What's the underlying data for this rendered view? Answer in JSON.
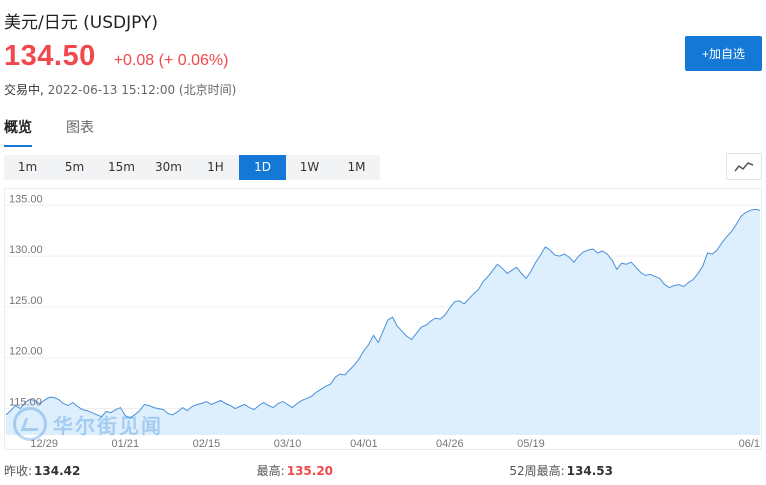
{
  "header": {
    "title": "美元/日元  (USDJPY)",
    "price": "134.50",
    "change": "+0.08 (+ 0.06%)",
    "status": "交易中,",
    "datetime": " 2022-06-13 15:12:00 (北京时间)"
  },
  "watch_button_label": "+加自选",
  "tabs": [
    {
      "label": "概览",
      "active": true
    },
    {
      "label": "图表",
      "active": false
    }
  ],
  "periods": [
    {
      "label": "1m"
    },
    {
      "label": "5m"
    },
    {
      "label": "15m"
    },
    {
      "label": "30m"
    },
    {
      "label": "1H"
    },
    {
      "label": "1D",
      "active": true
    },
    {
      "label": "1W"
    },
    {
      "label": "1M"
    }
  ],
  "chart_toggle_icon": "line-chart-icon",
  "watermark": {
    "text": "华尔街见闻",
    "icon": "wallstreetcn-logo-icon"
  },
  "colors": {
    "accent": "#1478d7",
    "up": "#f0484c",
    "area_fill": "#ddeefc",
    "line": "#4a90d9"
  },
  "stats": [
    {
      "label": "昨收:",
      "value": "134.42",
      "highlight": false
    },
    {
      "label": "最高:",
      "value": "135.20",
      "highlight": true
    },
    {
      "label": "52周最高:",
      "value": "134.53",
      "highlight": false
    }
  ],
  "chart_data": {
    "type": "area",
    "y_ticks": [
      "135.00",
      "130.00",
      "125.00",
      "120.00",
      "115.00"
    ],
    "y_tick_values": [
      135,
      130,
      125,
      120,
      115
    ],
    "x_ticks": [
      "12/29",
      "01/21",
      "02/15",
      "03/10",
      "04/01",
      "04/26",
      "05/19",
      "06/1"
    ],
    "x_tick_index": [
      8,
      25,
      42,
      59,
      75,
      93,
      110,
      127
    ],
    "ylim": [
      112.4,
      136.6
    ],
    "grid": true,
    "values": [
      114.4,
      114.8,
      115.3,
      115.0,
      115.6,
      115.9,
      115.8,
      115.5,
      115.8,
      116.1,
      116.1,
      115.9,
      115.5,
      115.3,
      115.6,
      115.2,
      114.9,
      114.8,
      114.6,
      114.4,
      114.2,
      114.7,
      114.6,
      114.9,
      115.1,
      114.3,
      114.1,
      114.4,
      114.8,
      115.4,
      115.3,
      115.1,
      115.0,
      114.9,
      114.5,
      114.4,
      114.7,
      115.1,
      114.8,
      115.2,
      115.4,
      115.5,
      115.7,
      115.4,
      115.6,
      115.8,
      115.5,
      115.3,
      115.0,
      115.2,
      115.4,
      115.1,
      114.9,
      115.3,
      115.6,
      115.3,
      115.1,
      115.5,
      115.7,
      115.4,
      115.1,
      115.5,
      115.8,
      116.0,
      116.2,
      116.6,
      116.9,
      117.2,
      117.4,
      118.1,
      118.4,
      118.3,
      118.8,
      119.3,
      119.9,
      120.7,
      121.3,
      122.2,
      121.5,
      122.6,
      123.7,
      124.0,
      123.1,
      122.6,
      122.1,
      121.8,
      122.4,
      123.0,
      123.2,
      123.6,
      123.9,
      123.8,
      124.2,
      124.9,
      125.5,
      125.6,
      125.3,
      125.8,
      126.3,
      126.7,
      127.5,
      128.0,
      128.6,
      129.2,
      128.8,
      128.3,
      128.6,
      128.9,
      128.3,
      127.8,
      128.5,
      129.4,
      130.1,
      130.9,
      130.6,
      130.1,
      130.0,
      130.2,
      129.9,
      129.4,
      130.0,
      130.4,
      130.6,
      130.7,
      130.3,
      130.5,
      130.2,
      129.6,
      128.7,
      129.3,
      129.2,
      129.4,
      128.9,
      128.4,
      128.1,
      128.2,
      128.0,
      127.8,
      127.2,
      126.9,
      127.1,
      127.2,
      127.0,
      127.4,
      127.7,
      128.3,
      129.0,
      130.3,
      130.2,
      130.6,
      131.3,
      131.9,
      132.4,
      133.1,
      133.9,
      134.3,
      134.5,
      134.6,
      134.5
    ]
  }
}
